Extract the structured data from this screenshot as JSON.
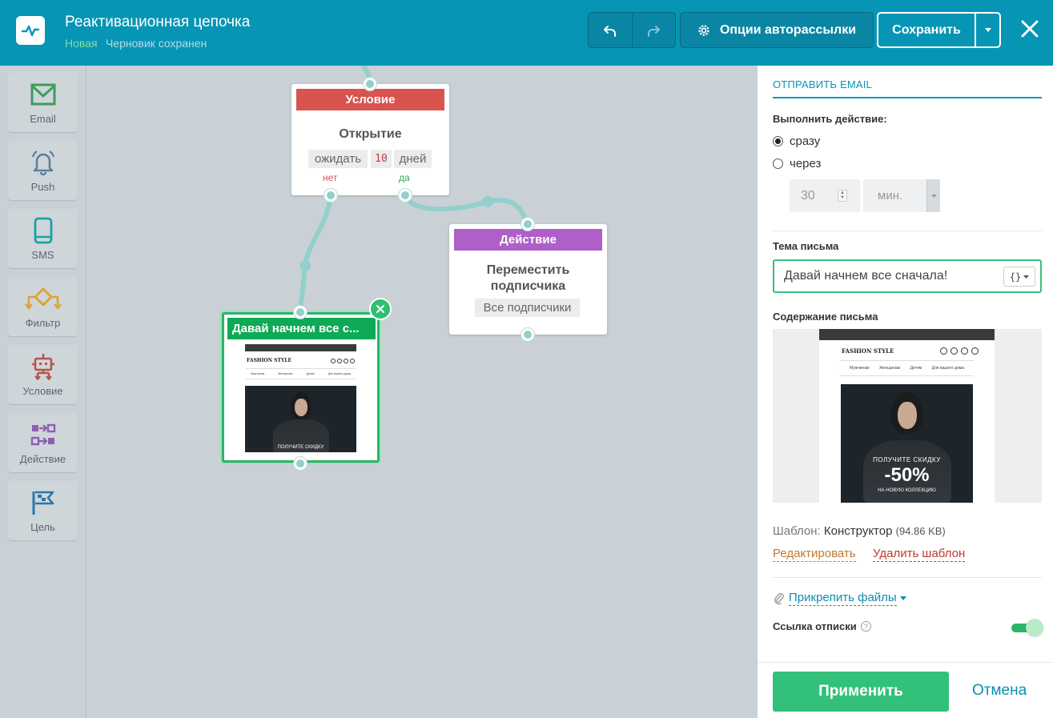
{
  "header": {
    "title": "Реактивационная цепочка",
    "status_new": "Новая",
    "status_draft": "Черновик сохранен",
    "options_label": "Опции авторассылки",
    "save_label": "Сохранить"
  },
  "toolbox": [
    {
      "label": "Email",
      "icon": "email-icon",
      "color": "#3e9b5d"
    },
    {
      "label": "Push",
      "icon": "bell-icon",
      "color": "#5b7f9a"
    },
    {
      "label": "SMS",
      "icon": "phone-icon",
      "color": "#1fa0a6"
    },
    {
      "label": "Фильтр",
      "icon": "filter-icon",
      "color": "#e0a135"
    },
    {
      "label": "Условие",
      "icon": "robot-icon",
      "color": "#b5554e"
    },
    {
      "label": "Действие",
      "icon": "action-icon",
      "color": "#8c5fb0"
    },
    {
      "label": "Цель",
      "icon": "flag-icon",
      "color": "#2a77ad"
    }
  ],
  "canvas": {
    "condition": {
      "header": "Условие",
      "header_color": "#d9534f",
      "title": "Открытие",
      "wait_label": "ожидать",
      "wait_value": "10",
      "wait_unit": "дней",
      "no_label": "нет",
      "yes_label": "да"
    },
    "action": {
      "header": "Действие",
      "header_color": "#ae5fc8",
      "title_line1": "Переместить",
      "title_line2": "подписчика",
      "chip": "Все подписчики"
    },
    "email": {
      "header": "Давай начнем все с...",
      "header_color": "#0eaa56"
    }
  },
  "email_template": {
    "brand": "FASHION STYLE",
    "menu": [
      "Мужчинам",
      "Женщинам",
      "Детям",
      "Для вашего дома"
    ],
    "promo_text": "ПОЛУЧИТЕ СКИДКУ",
    "discount": "-50%",
    "promo_sub": "НА НОВУЮ КОЛЛЕКЦИЮ"
  },
  "panel": {
    "section_title": "ОТПРАВИТЬ EMAIL",
    "perform_label": "Выполнить действие:",
    "option_now": "сразу",
    "option_after": "через",
    "selected_option": "сразу",
    "delay_value": "30",
    "delay_unit": "мин.",
    "subject_label": "Тема письма",
    "subject_value": "Давай начнем все сначала!",
    "content_label": "Содержание письма",
    "template_label": "Шаблон:",
    "template_name": "Конструктор",
    "template_size": "(94.86 KB)",
    "edit_link": "Редактировать",
    "delete_link": "Удалить шаблон",
    "attach_label": "Прикрепить файлы",
    "unsubscribe_label": "Ссылка отписки",
    "unsubscribe_enabled": true,
    "apply_label": "Применить",
    "cancel_label": "Отмена"
  },
  "colors": {
    "topbar": "#0795b5",
    "accent_green": "#33c07a",
    "link_blue": "#0a8fb0"
  }
}
